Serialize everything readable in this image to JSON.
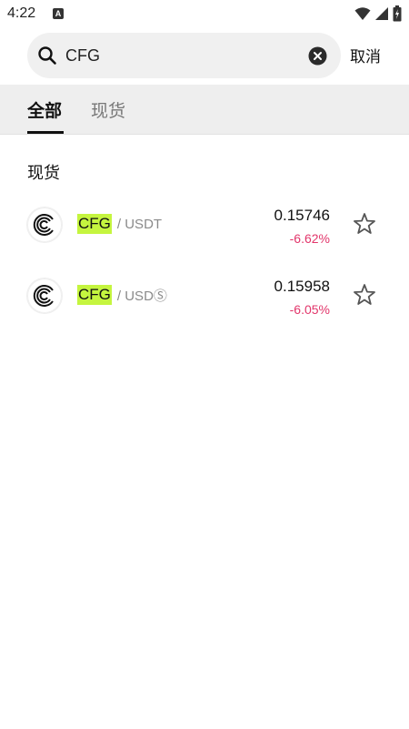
{
  "status": {
    "time": "4:22",
    "app_icon_letter": "A"
  },
  "search": {
    "query": "CFG",
    "placeholder": "",
    "cancel_label": "取消"
  },
  "tabs": [
    {
      "label": "全部",
      "active": true
    },
    {
      "label": "现货",
      "active": false
    }
  ],
  "section_title": "现货",
  "results": [
    {
      "base": "CFG",
      "quote": "/ USDT",
      "price": "0.15746",
      "change": "-6.62%"
    },
    {
      "base": "CFG",
      "quote": "/ USDⓈ",
      "price": "0.15958",
      "change": "-6.05%"
    }
  ],
  "colors": {
    "highlight": "#c5f53f",
    "negative": "#e2366b",
    "tab_bar_bg": "#eeeeee"
  }
}
